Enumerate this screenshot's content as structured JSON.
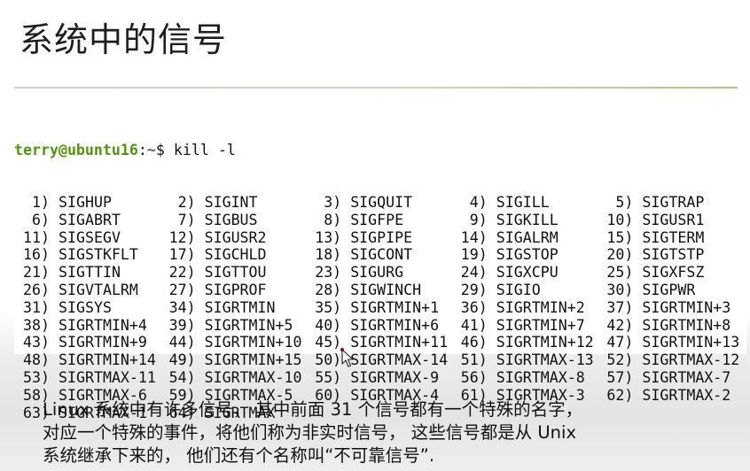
{
  "slide": {
    "title": "系统中的信号"
  },
  "terminal": {
    "prompt_user": "terry@ubuntu16",
    "prompt_colon": ":",
    "prompt_path": "~",
    "prompt_symbol": "$",
    "command": "kill -l",
    "signals": [
      {
        "num": "1)",
        "name": "SIGHUP"
      },
      {
        "num": "2)",
        "name": "SIGINT"
      },
      {
        "num": "3)",
        "name": "SIGQUIT"
      },
      {
        "num": "4)",
        "name": "SIGILL"
      },
      {
        "num": "5)",
        "name": "SIGTRAP"
      },
      {
        "num": "6)",
        "name": "SIGABRT"
      },
      {
        "num": "7)",
        "name": "SIGBUS"
      },
      {
        "num": "8)",
        "name": "SIGFPE"
      },
      {
        "num": "9)",
        "name": "SIGKILL"
      },
      {
        "num": "10)",
        "name": "SIGUSR1"
      },
      {
        "num": "11)",
        "name": "SIGSEGV"
      },
      {
        "num": "12)",
        "name": "SIGUSR2"
      },
      {
        "num": "13)",
        "name": "SIGPIPE"
      },
      {
        "num": "14)",
        "name": "SIGALRM"
      },
      {
        "num": "15)",
        "name": "SIGTERM"
      },
      {
        "num": "16)",
        "name": "SIGSTKFLT"
      },
      {
        "num": "17)",
        "name": "SIGCHLD"
      },
      {
        "num": "18)",
        "name": "SIGCONT"
      },
      {
        "num": "19)",
        "name": "SIGSTOP"
      },
      {
        "num": "20)",
        "name": "SIGTSTP"
      },
      {
        "num": "21)",
        "name": "SIGTTIN"
      },
      {
        "num": "22)",
        "name": "SIGTTOU"
      },
      {
        "num": "23)",
        "name": "SIGURG"
      },
      {
        "num": "24)",
        "name": "SIGXCPU"
      },
      {
        "num": "25)",
        "name": "SIGXFSZ"
      },
      {
        "num": "26)",
        "name": "SIGVTALRM"
      },
      {
        "num": "27)",
        "name": "SIGPROF"
      },
      {
        "num": "28)",
        "name": "SIGWINCH"
      },
      {
        "num": "29)",
        "name": "SIGIO"
      },
      {
        "num": "30)",
        "name": "SIGPWR"
      },
      {
        "num": "31)",
        "name": "SIGSYS"
      },
      {
        "num": "34)",
        "name": "SIGRTMIN"
      },
      {
        "num": "35)",
        "name": "SIGRTMIN+1"
      },
      {
        "num": "36)",
        "name": "SIGRTMIN+2"
      },
      {
        "num": "37)",
        "name": "SIGRTMIN+3"
      },
      {
        "num": "38)",
        "name": "SIGRTMIN+4"
      },
      {
        "num": "39)",
        "name": "SIGRTMIN+5"
      },
      {
        "num": "40)",
        "name": "SIGRTMIN+6"
      },
      {
        "num": "41)",
        "name": "SIGRTMIN+7"
      },
      {
        "num": "42)",
        "name": "SIGRTMIN+8"
      },
      {
        "num": "43)",
        "name": "SIGRTMIN+9"
      },
      {
        "num": "44)",
        "name": "SIGRTMIN+10"
      },
      {
        "num": "45)",
        "name": "SIGRTMIN+11"
      },
      {
        "num": "46)",
        "name": "SIGRTMIN+12"
      },
      {
        "num": "47)",
        "name": "SIGRTMIN+13"
      },
      {
        "num": "48)",
        "name": "SIGRTMIN+14"
      },
      {
        "num": "49)",
        "name": "SIGRTMIN+15"
      },
      {
        "num": "50)",
        "name": "SIGRTMAX-14"
      },
      {
        "num": "51)",
        "name": "SIGRTMAX-13"
      },
      {
        "num": "52)",
        "name": "SIGRTMAX-12"
      },
      {
        "num": "53)",
        "name": "SIGRTMAX-11"
      },
      {
        "num": "54)",
        "name": "SIGRTMAX-10"
      },
      {
        "num": "55)",
        "name": "SIGRTMAX-9"
      },
      {
        "num": "56)",
        "name": "SIGRTMAX-8"
      },
      {
        "num": "57)",
        "name": "SIGRTMAX-7"
      },
      {
        "num": "58)",
        "name": "SIGRTMAX-6"
      },
      {
        "num": "59)",
        "name": "SIGRTMAX-5"
      },
      {
        "num": "60)",
        "name": "SIGRTMAX-4"
      },
      {
        "num": "61)",
        "name": "SIGRTMAX-3"
      },
      {
        "num": "62)",
        "name": "SIGRTMAX-2"
      },
      {
        "num": "63)",
        "name": "SIGRTMAX-1"
      },
      {
        "num": "64)",
        "name": "SIGRTMAX"
      }
    ]
  },
  "caption": {
    "lines": [
      "Linux 系统中有许多信号， 其中前面 31 个信号都有一个特殊的名字，",
      "对应一个特殊的事件，将他们称为非实时信号， 这些信号都是从 Unix",
      "系统继承下来的， 他们还有个名称叫“不可靠信号”."
    ]
  },
  "colors": {
    "prompt_user": "#4e9a06",
    "prompt_path": "#3465a4",
    "text": "#111111"
  },
  "icons": {
    "cursor": "mouse-pointer-icon"
  }
}
